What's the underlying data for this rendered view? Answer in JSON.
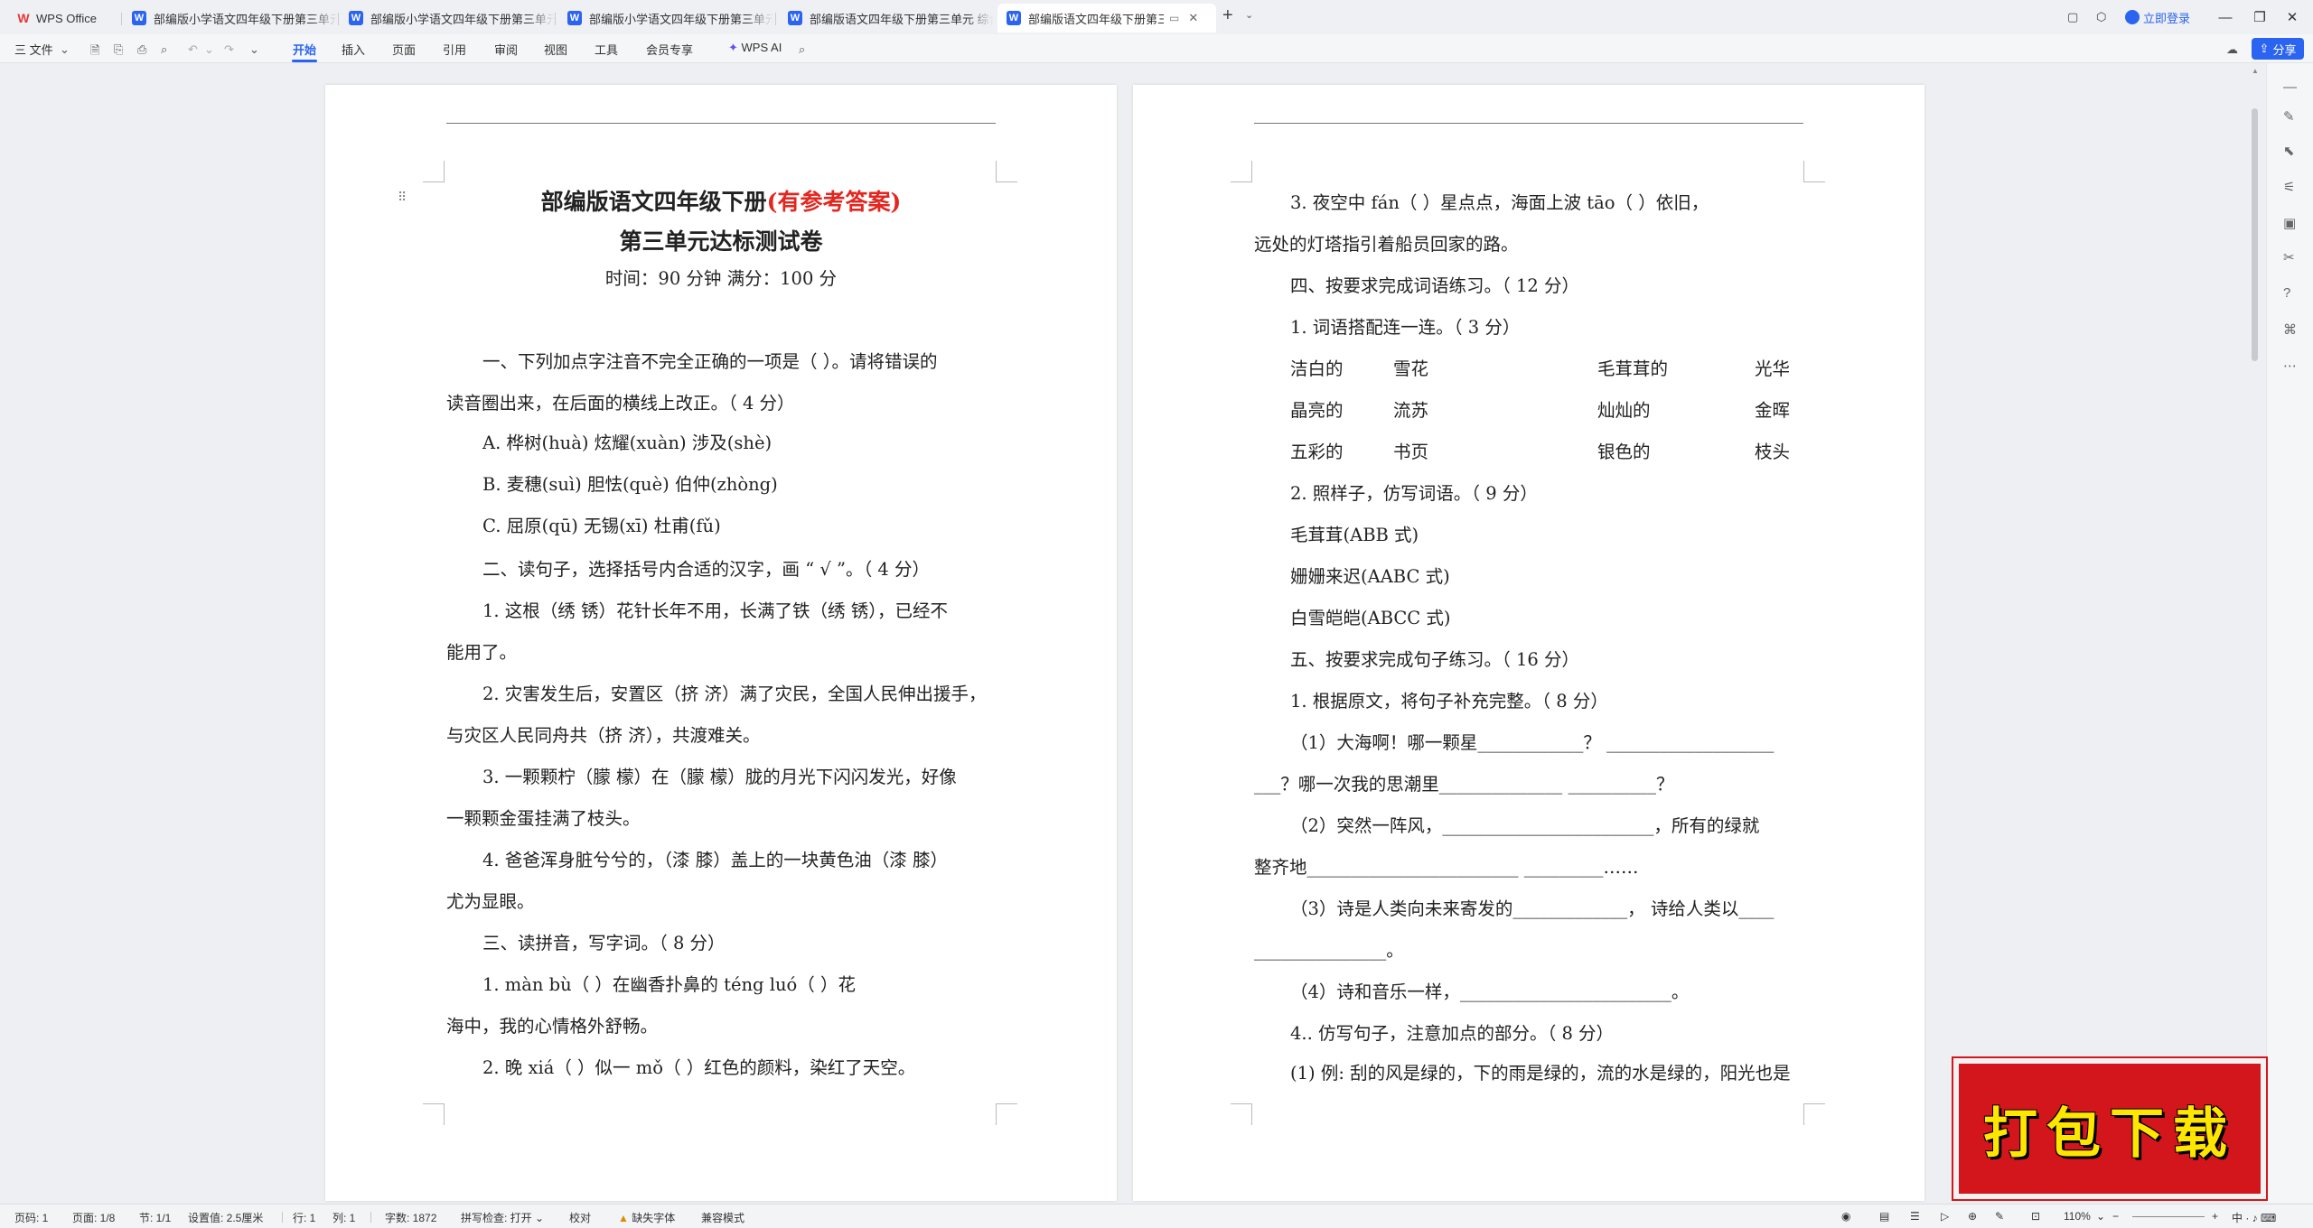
{
  "tabs": [
    {
      "label": "WPS Office",
      "type": "home"
    },
    {
      "label": "部编版小学语文四年级下册第三单元...",
      "type": "doc"
    },
    {
      "label": "部编版小学语文四年级下册第三单元...",
      "type": "doc"
    },
    {
      "label": "部编版小学语文四年级下册第三单元...",
      "type": "doc"
    },
    {
      "label": "部编版语文四年级下册第三单元 综合...",
      "type": "doc"
    },
    {
      "label": "部编版语文四年级下册第三单...",
      "type": "doc",
      "active": true
    }
  ],
  "titlebar": {
    "login": "立即登录"
  },
  "ribbon": {
    "file": "三 文件",
    "tabs": [
      "开始",
      "插入",
      "页面",
      "引用",
      "审阅",
      "视图",
      "工具",
      "会员专享"
    ],
    "active_tab": "开始",
    "ai": "WPS AI",
    "share": "分享"
  },
  "page1": {
    "title_main": "部编版语文四年级下册",
    "title_red": "(有参考答案)",
    "subtitle": "第三单元达标测试卷",
    "meta": "时间：90 分钟    满分：100 分",
    "lines": [
      "一、下列加点字注音不完全正确的一项是（      ）。请将错误的",
      "读音圈出来，在后面的横线上改正。（ 4 分）",
      "A. 桦树(huà)    炫耀(xuàn)    涉及(shè)",
      "B. 麦穗(suì)    胆怯(què)    伯仲(zhòng)",
      "C. 屈原(qū)     无锡(xī)      杜甫(fǔ)",
      "二、读句子，选择括号内合适的汉字，画 “ √ ”。（ 4 分）",
      "1. 这根（绣   锈）花针长年不用，长满了铁（绣   锈），已经不",
      "能用了。",
      "2. 灾害发生后，安置区（挤   济）满了灾民，全国人民伸出援手，",
      "与灾区人民同舟共（挤   济），共渡难关。",
      "3. 一颗颗柠（朦   檬）在（朦   檬）胧的月光下闪闪发光，好像",
      "一颗颗金蛋挂满了枝头。",
      "4. 爸爸浑身脏兮兮的，（漆   膝）盖上的一块黄色油（漆   膝）",
      "尤为显眼。",
      "三、读拼音，写字词。（ 8 分）",
      "1. màn bù（            ）在幽香扑鼻的 téng luó（            ）花",
      "海中，我的心情格外舒畅。",
      "2. 晚 xiá（        ）似一 mǒ（        ）红色的颜料，染红了天空。"
    ]
  },
  "page2": {
    "lines": [
      "3. 夜空中 fán（        ）星点点，海面上波 tāo（        ）依旧，",
      "远处的灯塔指引着船员回家的路。",
      "四、按要求完成词语练习。（ 12 分）",
      "1. 词语搭配连一连。（ 3 分）",
      "2. 照样子，仿写词语。（ 9 分）",
      "毛茸茸(ABB 式)",
      "姗姗来迟(AABC 式)",
      "白雪皑皑(ABCC 式)",
      "五、按要求完成句子练习。（ 16 分）",
      "1. 根据原文，将句子补充完整。（ 8 分）",
      "（1）大海啊！哪一颗星____________？ ___________________",
      "___？哪一次我的思潮里______________ __________？",
      "（2）突然一阵风，________________________，所有的绿就",
      "整齐地________________________ _________……",
      "（3）诗是人类向未来寄发的_____________， 诗给人类以____",
      "_______________。",
      "（4）诗和音乐一样，________________________。",
      "4.. 仿写句子，注意加点的部分。（ 8 分）",
      "(1) 例: 刮的风是绿的，下的雨是绿的，流的水是绿的，阳光也是"
    ],
    "match_table": [
      [
        "洁白的",
        "雪花",
        "毛茸茸的",
        "光华"
      ],
      [
        "晶亮的",
        "流苏",
        "灿灿的",
        "金晖"
      ],
      [
        "五彩的",
        "书页",
        "银色的",
        "枝头"
      ]
    ]
  },
  "statusbar": {
    "page_no": "页码: 1",
    "page_of": "页面: 1/8",
    "section": "节: 1/1",
    "setting": "设置值: 2.5厘米",
    "row": "行: 1",
    "col": "列: 1",
    "words": "字数: 1872",
    "spell": "拼写检查: 打开 ⌄",
    "proof": "校对",
    "missing_font": "缺失字体",
    "compat": "兼容模式",
    "zoom": "110%"
  },
  "banner": {
    "text": "打包下载"
  }
}
